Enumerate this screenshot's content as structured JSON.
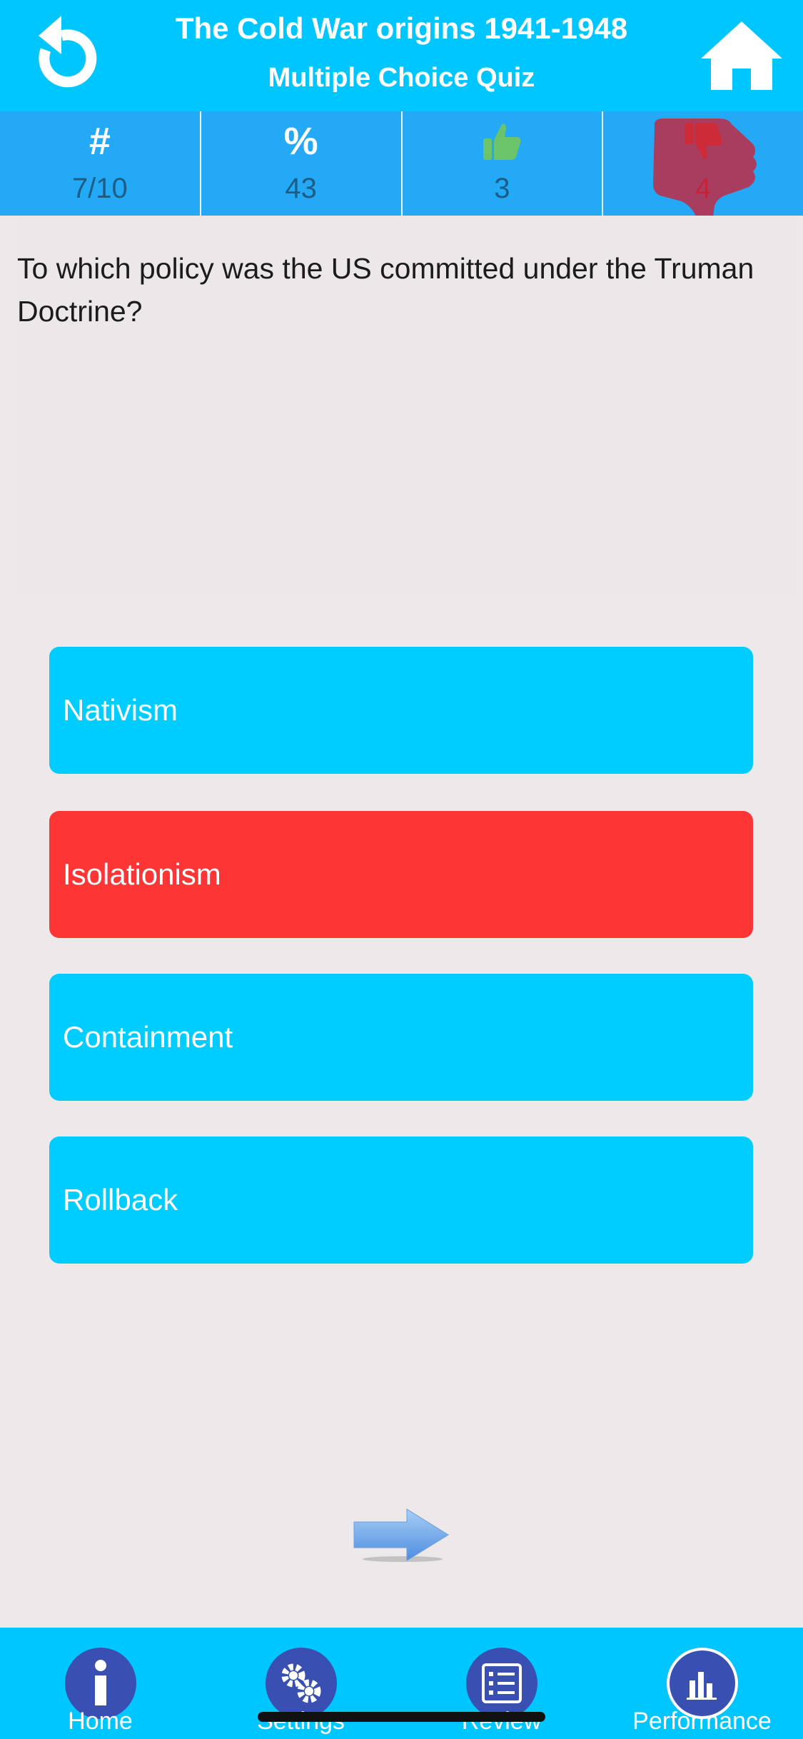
{
  "header": {
    "title": "The Cold War origins 1941-1948",
    "subtitle": "Multiple Choice Quiz",
    "back_icon": "restart-arrow-icon",
    "home_icon": "home-icon",
    "background": "#00c6ff"
  },
  "stats": {
    "number": {
      "icon": "#",
      "value": "7/10"
    },
    "percent": {
      "icon": "%",
      "value": "43"
    },
    "correct": {
      "icon": "thumbs-up-icon",
      "value": "3"
    },
    "wrong": {
      "icon": "thumbs-down-icon",
      "value": "4"
    }
  },
  "question": {
    "text": "To which policy was the US committed under the Truman Doctrine?"
  },
  "answers": [
    {
      "label": "Nativism",
      "state": "normal"
    },
    {
      "label": "Isolationism",
      "state": "wrong"
    },
    {
      "label": "Containment",
      "state": "normal"
    },
    {
      "label": "Rollback",
      "state": "normal"
    }
  ],
  "next_icon": "next-arrow-icon",
  "tabbar": {
    "items": [
      {
        "label": "Home",
        "icon": "info-icon"
      },
      {
        "label": "Settings",
        "icon": "gears-icon"
      },
      {
        "label": "Review",
        "icon": "checklist-icon"
      },
      {
        "label": "Performance",
        "icon": "bar-chart-icon"
      }
    ]
  },
  "colors": {
    "accent": "#00c6ff",
    "answer": "#00cdff",
    "wrong": "#fd3535",
    "stats_bar": "#23a9f5",
    "tab_circle": "#3a4fb2"
  }
}
